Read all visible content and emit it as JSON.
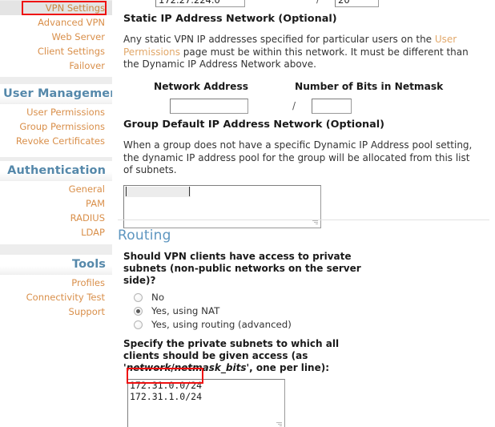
{
  "sidebar": {
    "groups": [
      {
        "header": null,
        "items": [
          {
            "label": "VPN Settings",
            "selected": true
          },
          {
            "label": "Advanced VPN",
            "selected": false
          },
          {
            "label": "Web Server",
            "selected": false
          },
          {
            "label": "Client Settings",
            "selected": false
          },
          {
            "label": "Failover",
            "selected": false
          }
        ]
      },
      {
        "header": "User Management",
        "items": [
          {
            "label": "User Permissions",
            "selected": false
          },
          {
            "label": "Group Permissions",
            "selected": false
          },
          {
            "label": "Revoke Certificates",
            "selected": false
          }
        ]
      },
      {
        "header": "Authentication",
        "items": [
          {
            "label": "General",
            "selected": false
          },
          {
            "label": "PAM",
            "selected": false
          },
          {
            "label": "RADIUS",
            "selected": false
          },
          {
            "label": "LDAP",
            "selected": false
          }
        ]
      },
      {
        "header": "Tools",
        "items": [
          {
            "label": "Profiles",
            "selected": false
          },
          {
            "label": "Connectivity Test",
            "selected": false
          },
          {
            "label": "Support",
            "selected": false
          }
        ]
      }
    ]
  },
  "main": {
    "dynamic_network": {
      "address_value": "172.27.224.0",
      "separator": "/",
      "bits_value": "20"
    },
    "static_section": {
      "heading": "Static IP Address Network (Optional)",
      "description_part1": "Any static VPN IP addresses specified for particular users on the ",
      "description_link": "User Permissions",
      "description_part2": " page must be within this network. It must be different than the Dynamic IP Address Network above.",
      "label_network_address": "Network Address",
      "label_bits": "Number of Bits in Netmask",
      "network_address_value": "",
      "separator": "/",
      "bits_value": ""
    },
    "group_section": {
      "heading": "Group Default IP Address Network (Optional)",
      "description": "When a group does not have a specific Dynamic IP Address pool setting, the dynamic IP address pool for the group will be allocated from this list of subnets.",
      "textarea_value": ""
    },
    "routing_section": {
      "heading": "Routing",
      "question": "Should VPN clients have access to private subnets (non-public networks on the server side)?",
      "options": [
        {
          "label": "No",
          "checked": false
        },
        {
          "label": "Yes, using NAT",
          "checked": true
        },
        {
          "label": "Yes, using routing (advanced)",
          "checked": false
        }
      ],
      "subnets_label_part1": "Specify the private subnets to which all clients should be given access (as '",
      "subnets_label_em1": "network",
      "subnets_label_sep": "/",
      "subnets_label_em2": "netmask_bits",
      "subnets_label_part2": "', one per line):",
      "subnets_value": "172.31.0.0/24\n172.31.1.0/24"
    }
  },
  "annotations": {
    "accent_color": "#ee1111",
    "boxes": [
      {
        "name": "vpn-settings-highlight"
      },
      {
        "name": "subnet-line-highlight"
      }
    ]
  },
  "colors": {
    "nav_link": "#d98f4a",
    "nav_header": "#5588aa",
    "routing_heading": "#5e96c0",
    "inline_link": "#e2a86a",
    "annotation_red": "#ee1111"
  }
}
